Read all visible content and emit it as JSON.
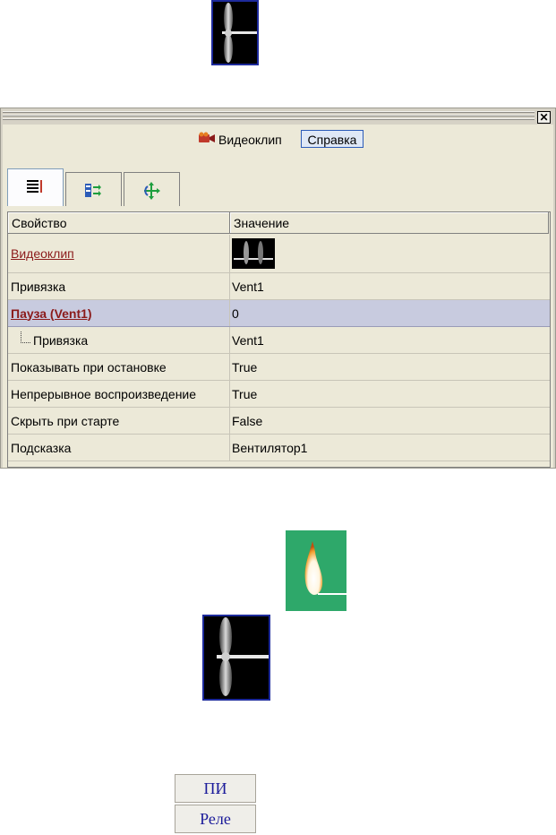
{
  "panel": {
    "close_label": "✕",
    "title": "Видеоклип",
    "help_label": "Справка",
    "tabs": [
      {
        "name": "properties-tab",
        "icon": "property-list-icon",
        "active": true
      },
      {
        "name": "events-tab",
        "icon": "events-icon",
        "active": false
      },
      {
        "name": "motion-tab",
        "icon": "move-icon",
        "active": false
      }
    ],
    "grid": {
      "headers": {
        "property": "Свойство",
        "value": "Значение"
      },
      "rows": [
        {
          "property": "Видеоклип",
          "value": ""
        },
        {
          "property": "Привязка",
          "value": "Vent1"
        },
        {
          "property": "Пауза (Vent1)",
          "value": "0"
        },
        {
          "property": "Привязка",
          "value": "Vent1"
        },
        {
          "property": "Показывать при остановке",
          "value": "True"
        },
        {
          "property": "Непрерывное воспроизведение",
          "value": "True"
        },
        {
          "property": "Скрыть при старте",
          "value": "False"
        },
        {
          "property": "Подсказка",
          "value": "Вентилятор1"
        }
      ]
    }
  },
  "mode_buttons": {
    "pi_label": "ПИ",
    "relay_label": "Реле"
  },
  "colors": {
    "accent_link": "#8b1a1a",
    "selection": "#c8cbdf",
    "flame_bg": "#2ea86a",
    "button_text": "#1a1a9a"
  }
}
